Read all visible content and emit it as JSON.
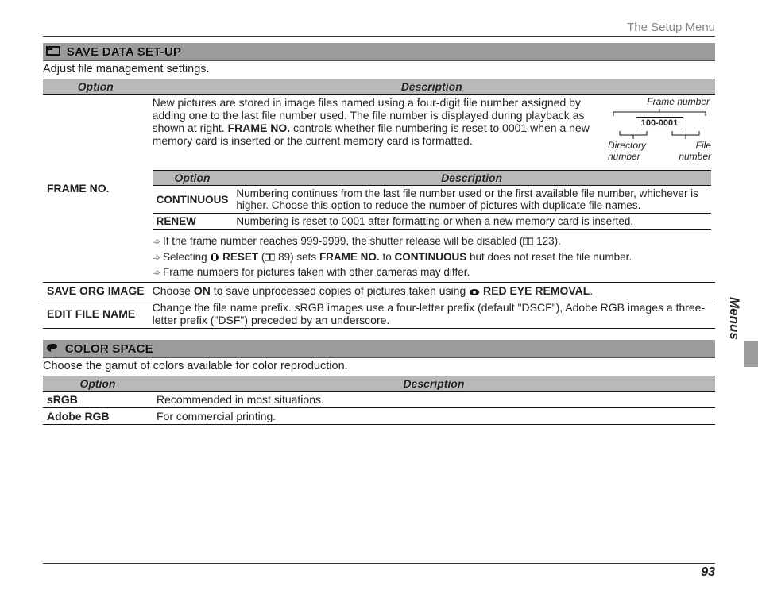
{
  "header": {
    "chapter": "The Setup Menu"
  },
  "sidetab": {
    "label": "Menus"
  },
  "page_number": "93",
  "sections": [
    {
      "id": "save_data",
      "title": "SAVE DATA SET-UP",
      "icon": "folder-icon",
      "intro": "Adjust file management settings.",
      "col_option": "Option",
      "col_desc": "Description",
      "rows": {
        "frame_no": {
          "label": "FRAME NO.",
          "desc_pre": "New pictures are stored in image files named using a four-digit file number assigned by adding one to the last file number used.  The file number is displayed during playback as shown at right.  ",
          "desc_bold": "FRAME NO.",
          "desc_post": " controls whether file numbering is reset to 0001 when a new memory card is inserted or the current memory card is formatted.",
          "diagram": {
            "top_label": "Frame number",
            "sample": "100-0001",
            "left_label_1": "Directory",
            "left_label_2": "number",
            "right_label_1": "File",
            "right_label_2": "number"
          },
          "inner_col_option": "Option",
          "inner_col_desc": "Description",
          "inner_rows": {
            "continuous": {
              "label": "CONTINUOUS",
              "desc": "Numbering continues from the last file number used or the first available file number, whichever is higher.  Choose this option to reduce the number of pictures with duplicate file names."
            },
            "renew": {
              "label": "RENEW",
              "desc": "Numbering is reset to 0001 after formatting or when a new memory card is inserted."
            }
          },
          "notes": {
            "n1_a": "If the frame number reaches 999-9999, the shutter release will be disabled (",
            "n1_ref": "123",
            "n1_b": ").",
            "n2_a": "Selecting ",
            "n2_reset": "RESET",
            "n2_b": " (",
            "n2_ref": "89",
            "n2_c": ") sets ",
            "n2_frame": "FRAME NO.",
            "n2_d": " to ",
            "n2_cont": "CONTINUOUS",
            "n2_e": " but does not reset the file number.",
            "n3": "Frame numbers for pictures taken with other cameras may differ."
          }
        },
        "save_org": {
          "label": "SAVE ORG IMAGE",
          "desc_a": "Choose ",
          "desc_on": "ON",
          "desc_b": " to save unprocessed copies of pictures taken using ",
          "desc_feat": "RED EYE REMOVAL",
          "desc_c": "."
        },
        "edit_file": {
          "label": "EDIT FILE NAME",
          "desc": "Change the file name prefix.  sRGB images use a four-letter prefix (default \"DSCF\"), Adobe RGB images a three-letter prefix (\"DSF\") preceded by an underscore."
        }
      }
    },
    {
      "id": "color_space",
      "title": "COLOR SPACE",
      "icon": "palette-icon",
      "intro": "Choose the gamut of colors available for color reproduction.",
      "col_option": "Option",
      "col_desc": "Description",
      "rows": {
        "srgb": {
          "label": "sRGB",
          "desc": "Recommended in most situations."
        },
        "adobe": {
          "label": "Adobe RGB",
          "desc": "For commercial printing."
        }
      }
    }
  ]
}
